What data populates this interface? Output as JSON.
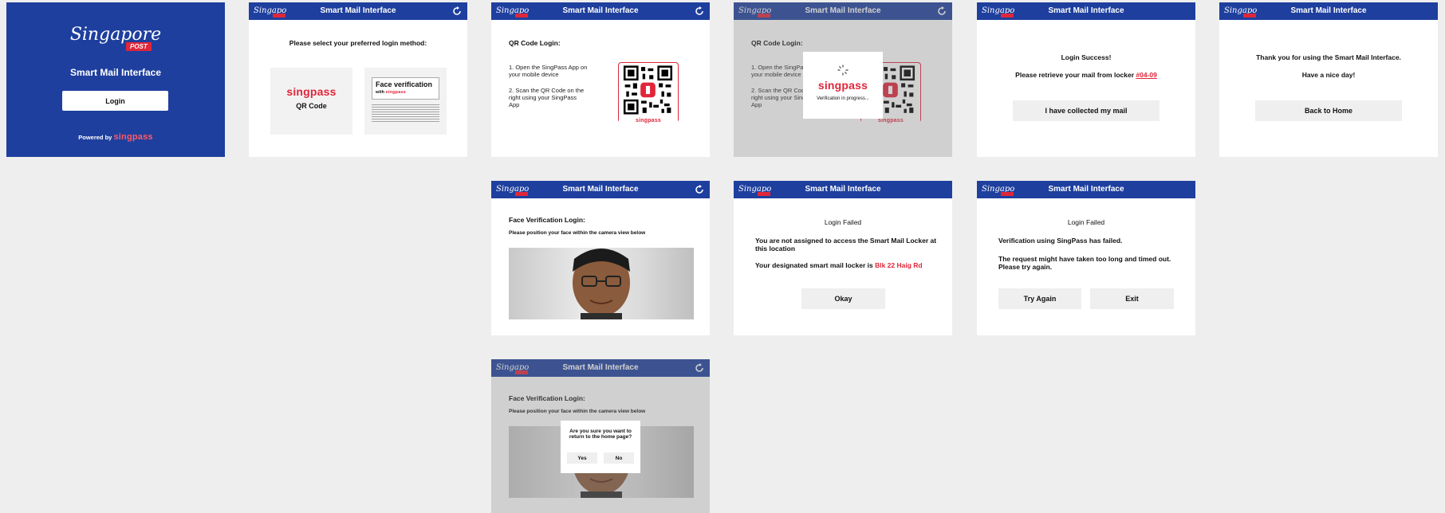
{
  "app": {
    "title": "Smart Mail Interface",
    "brand": "Singapore",
    "brand_sub": "POST",
    "singpass": "singpass"
  },
  "welcome": {
    "title": "Smart Mail Interface",
    "login_button": "Login",
    "powered_by": "Powered by",
    "powered_brand": "singpass"
  },
  "select": {
    "prompt": "Please select your preferred login method:",
    "qr_option": "QR Code",
    "face_title": "Face verification",
    "face_with": "with",
    "face_brand": "singpass"
  },
  "qr": {
    "heading": "QR Code Login:",
    "step1": "1. Open the SingPass App on your mobile device",
    "step2": "2. Scan the QR Code on the right using your SingPass App"
  },
  "progress": {
    "text": "Verification in progress..."
  },
  "success": {
    "title": "Login Success!",
    "message_prefix": "Please retrieve your mail from locker ",
    "locker": "#04-09",
    "collected_button": "I have collected my mail"
  },
  "thanks": {
    "line1": "Thank you for using the Smart Mail Interface.",
    "line2": "Have a nice day!",
    "home_button": "Back to Home"
  },
  "face": {
    "heading": "Face Verification Login:",
    "instruction": "Please position your face within the camera view below"
  },
  "failed_locker": {
    "title": "Login Failed",
    "line1": "You are not assigned to access the Smart Mail Locker at this location",
    "line2_prefix": "Your designated smart mail locker is ",
    "location": "Blk 22 Haig Rd",
    "okay_button": "Okay"
  },
  "failed_timeout": {
    "title": "Login Failed",
    "line1": "Verification using SingPass has failed.",
    "line2": "The request might have taken too long and timed out. Please try again.",
    "retry_button": "Try Again",
    "exit_button": "Exit"
  },
  "confirm": {
    "question": "Are you sure you want to return to the home page?",
    "yes": "Yes",
    "no": "No"
  },
  "colors": {
    "brand_blue": "#1e3f9e",
    "singpass_red": "#e0263a",
    "button_grey": "#efefef",
    "page_bg": "#eeeeee"
  }
}
